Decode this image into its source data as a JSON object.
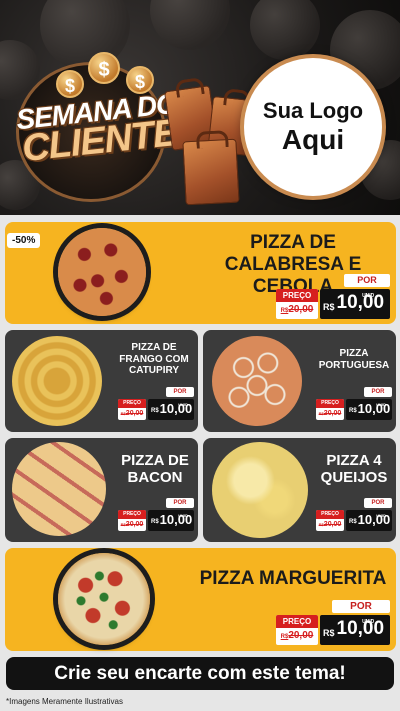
{
  "header": {
    "title_line1": "SEMANA DO",
    "title_line2": "CLIENTE",
    "dollar_sign": "$",
    "logo_line1": "Sua Logo",
    "logo_line2": "Aqui"
  },
  "products": [
    {
      "badge": "-50%",
      "name": "PIZZA DE CALABRESA E CEBOLA",
      "preco_label": "PREÇO",
      "old_prefix": "R$",
      "old_price": "20,00",
      "por_label": "POR",
      "currency": "R$",
      "price": "10,00",
      "unit": "UNID"
    },
    {
      "name": "PIZZA DE FRANGO COM CATUPIRY",
      "preco_label": "PREÇO",
      "old_prefix": "R$",
      "old_price": "20,00",
      "por_label": "POR",
      "currency": "R$",
      "price": "10,00",
      "unit": "UNID"
    },
    {
      "name": "PIZZA PORTUGUESA",
      "preco_label": "PREÇO",
      "old_prefix": "R$",
      "old_price": "20,00",
      "por_label": "POR",
      "currency": "R$",
      "price": "10,00",
      "unit": "UNID"
    },
    {
      "name": "PIZZA DE BACON",
      "preco_label": "PREÇO",
      "old_prefix": "R$",
      "old_price": "20,00",
      "por_label": "POR",
      "currency": "R$",
      "price": "10,00",
      "unit": "UNID"
    },
    {
      "name": "PIZZA 4 QUEIJOS",
      "preco_label": "PREÇO",
      "old_prefix": "R$",
      "old_price": "20,00",
      "por_label": "POR",
      "currency": "R$",
      "price": "10,00",
      "unit": "UNID"
    },
    {
      "name": "PIZZA MARGUERITA",
      "preco_label": "PREÇO",
      "old_prefix": "R$",
      "old_price": "20,00",
      "por_label": "POR",
      "currency": "R$",
      "price": "10,00",
      "unit": "UNID"
    }
  ],
  "footer": {
    "cta": "Crie seu encarte com este tema!",
    "disclaimer": "*Imagens Meramente Ilustrativas"
  },
  "colors": {
    "yellow": "#f6b420",
    "dark_card": "#3b3b3b",
    "price_red": "#d61f1f",
    "header_bg": "#1c1a19"
  }
}
